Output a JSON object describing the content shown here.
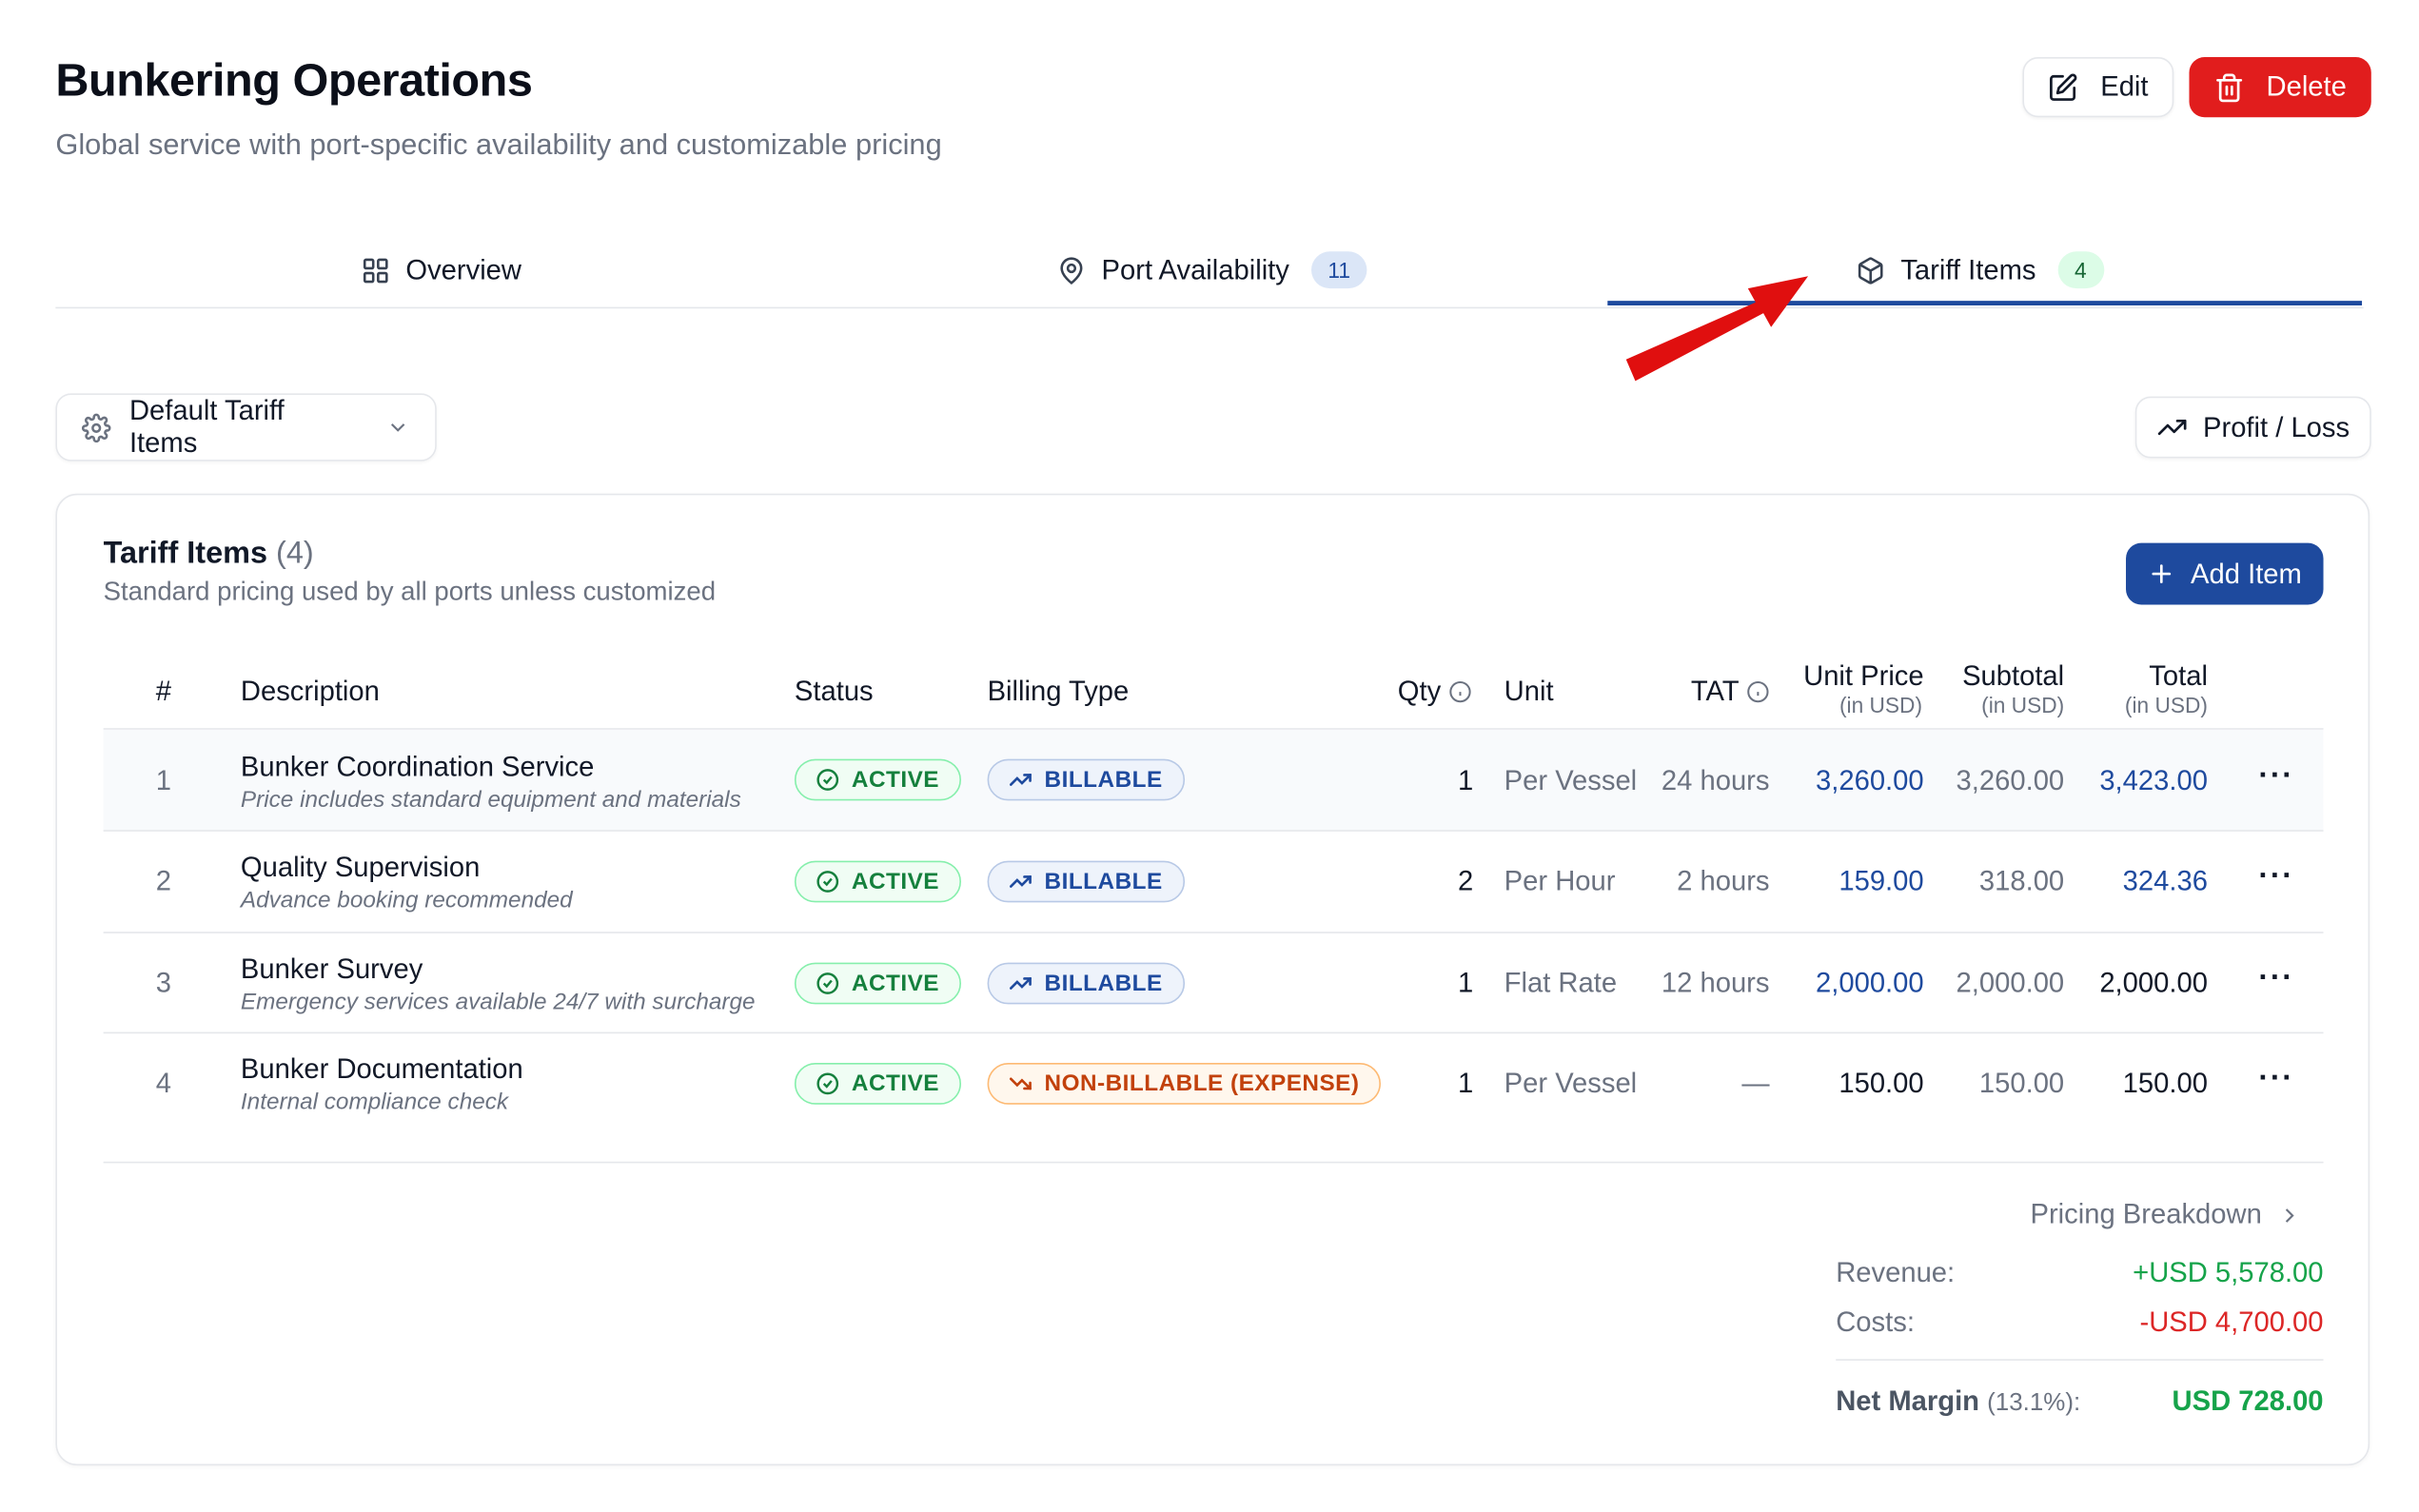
{
  "header": {
    "title": "Bunkering Operations",
    "subtitle": "Global service with port-specific availability and customizable pricing",
    "edit_label": "Edit",
    "delete_label": "Delete"
  },
  "tabs": [
    {
      "label": "Overview",
      "icon": "grid-icon"
    },
    {
      "label": "Port Availability",
      "badge": "11",
      "icon": "map-pin-icon"
    },
    {
      "label": "Tariff Items",
      "badge": "4",
      "icon": "package-icon",
      "active": true
    }
  ],
  "toolbar": {
    "dropdown_label": "Default Tariff Items",
    "profit_loss_label": "Profit / Loss"
  },
  "card": {
    "title": "Tariff Items",
    "count": "(4)",
    "subtitle": "Standard pricing used by all ports unless customized",
    "add_label": "Add Item"
  },
  "table": {
    "headers": {
      "num": "#",
      "description": "Description",
      "status": "Status",
      "billing_type": "Billing Type",
      "qty": "Qty",
      "unit": "Unit",
      "tat": "TAT",
      "unit_price": "Unit Price",
      "subtotal": "Subtotal",
      "total": "Total",
      "currency_note": "(in USD)"
    },
    "rows": [
      {
        "num": "1",
        "description": "Bunker Coordination Service",
        "note": "Price includes standard equipment and materials",
        "status": "ACTIVE",
        "billing": "BILLABLE",
        "qty": "1",
        "unit": "Per Vessel",
        "tat": "24 hours",
        "unit_price": "3,260.00",
        "subtotal": "3,260.00",
        "total": "3,423.00"
      },
      {
        "num": "2",
        "description": "Quality Supervision",
        "note": "Advance booking recommended",
        "status": "ACTIVE",
        "billing": "BILLABLE",
        "qty": "2",
        "unit": "Per Hour",
        "tat": "2 hours",
        "unit_price": "159.00",
        "subtotal": "318.00",
        "total": "324.36"
      },
      {
        "num": "3",
        "description": "Bunker Survey",
        "note": "Emergency services available 24/7 with surcharge",
        "status": "ACTIVE",
        "billing": "BILLABLE",
        "qty": "1",
        "unit": "Flat Rate",
        "tat": "12 hours",
        "unit_price": "2,000.00",
        "subtotal": "2,000.00",
        "total": "2,000.00"
      },
      {
        "num": "4",
        "description": "Bunker Documentation",
        "note": "Internal compliance check",
        "status": "ACTIVE",
        "billing": "NON-BILLABLE (EXPENSE)",
        "qty": "1",
        "unit": "Per Vessel",
        "tat": "—",
        "unit_price": "150.00",
        "subtotal": "150.00",
        "total": "150.00"
      }
    ]
  },
  "summary": {
    "breakdown_label": "Pricing Breakdown",
    "revenue_label": "Revenue:",
    "revenue_value": "+USD 5,578.00",
    "costs_label": "Costs:",
    "costs_value": "-USD 4,700.00",
    "net_label": "Net Margin",
    "net_pct": "(13.1%):",
    "net_value": "USD 728.00"
  },
  "colors": {
    "primary": "#1e4a9e",
    "danger": "#e11d1d",
    "success": "#16a34a",
    "warning": "#c2410c"
  }
}
